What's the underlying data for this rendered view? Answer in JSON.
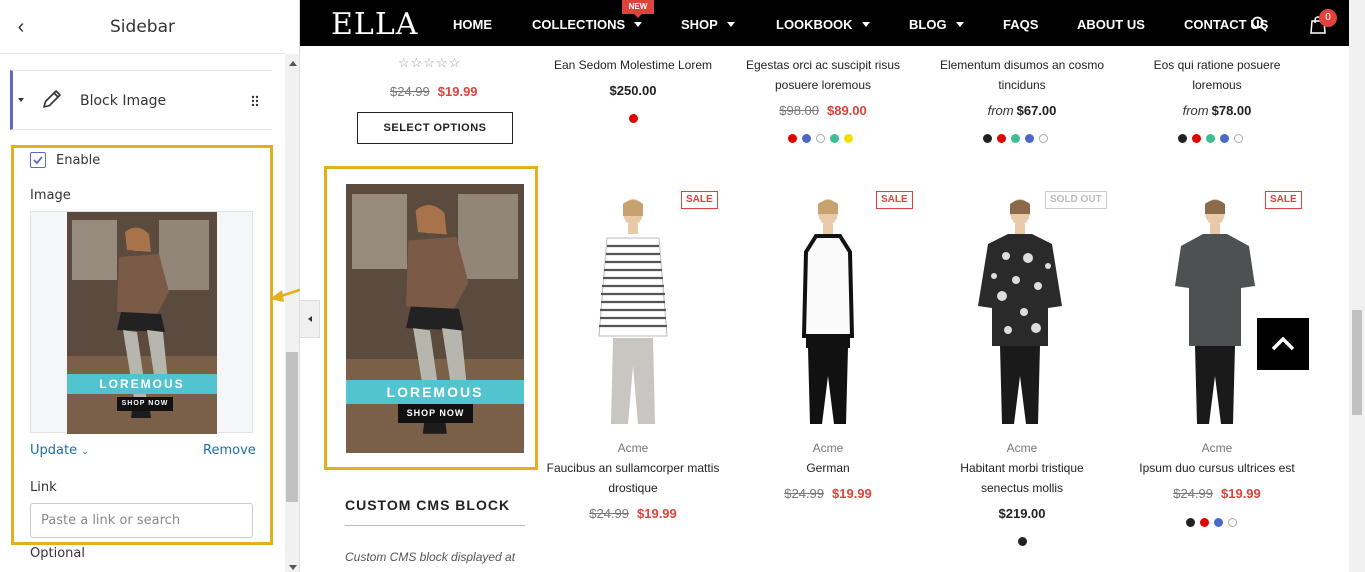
{
  "sidebar": {
    "title": "Sidebar",
    "block": {
      "label": "Block Image"
    },
    "enable_label": "Enable",
    "image_label": "Image",
    "update_label": "Update",
    "remove_label": "Remove",
    "link_label": "Link",
    "link_placeholder": "Paste a link or search",
    "optional_label": "Optional",
    "promo_banner": "LOREMOUS",
    "promo_button": "SHOP NOW"
  },
  "nav": {
    "logo": "ELLA",
    "items": [
      {
        "label": "HOME"
      },
      {
        "label": "COLLECTIONS",
        "badge": "NEW"
      },
      {
        "label": "SHOP"
      },
      {
        "label": "LOOKBOOK"
      },
      {
        "label": "BLOG"
      },
      {
        "label": "FAQS"
      },
      {
        "label": "ABOUT US"
      },
      {
        "label": "CONTACT US"
      }
    ],
    "cart_count": "0"
  },
  "top_products": [
    {
      "stars": "☆☆☆☆☆",
      "old": "$24.99",
      "price": "$19.99",
      "button": "SELECT OPTIONS"
    },
    {
      "title_lines": [
        "Ean Sedom Molestime Lorem"
      ],
      "price": "$250.00",
      "swatches": [
        "#e00000"
      ]
    },
    {
      "title_lines": [
        "Egestas orci ac suscipit risus",
        "posuere loremous"
      ],
      "old": "$98.00",
      "price": "$89.00",
      "swatches": [
        "#e00000",
        "#4a68c4",
        "#ffffff",
        "#3fbf8f",
        "#f0e000"
      ]
    },
    {
      "title_lines": [
        "Elementum disumos an cosmo",
        "tinciduns"
      ],
      "from": "from",
      "price": "$67.00",
      "swatches": [
        "#222222",
        "#e00000",
        "#3fbf8f",
        "#4a68c4",
        "#ffffff"
      ]
    },
    {
      "title_lines": [
        "Eos qui ratione posuere",
        "loremous"
      ],
      "from": "from",
      "price": "$78.00",
      "swatches": [
        "#222222",
        "#e00000",
        "#3fbf8f",
        "#4a68c4",
        "#ffffff"
      ]
    }
  ],
  "promo": {
    "banner": "LOREMOUS",
    "button": "SHOP NOW"
  },
  "cms": {
    "title": "CUSTOM CMS BLOCK",
    "text": "Custom CMS block displayed at"
  },
  "products": [
    {
      "tag": "SALE",
      "vendor": "Acme",
      "title_lines": [
        "Faucibus an sullamcorper mattis",
        "drostique"
      ],
      "old": "$24.99",
      "price": "$19.99"
    },
    {
      "tag": "SALE",
      "vendor": "Acme",
      "title_lines": [
        "German"
      ],
      "old": "$24.99",
      "price": "$19.99"
    },
    {
      "tag": "SOLD OUT",
      "vendor": "Acme",
      "title_lines": [
        "Habitant morbi tristique",
        "senectus mollis"
      ],
      "price": "$219.00",
      "swatches": [
        "#222222"
      ]
    },
    {
      "tag": "SALE",
      "vendor": "Acme",
      "title_lines": [
        "Ipsum duo cursus ultrices est"
      ],
      "old": "$24.99",
      "price": "$19.99",
      "swatches": [
        "#222222",
        "#e00000",
        "#4a68c4",
        "#ffffff"
      ]
    }
  ]
}
